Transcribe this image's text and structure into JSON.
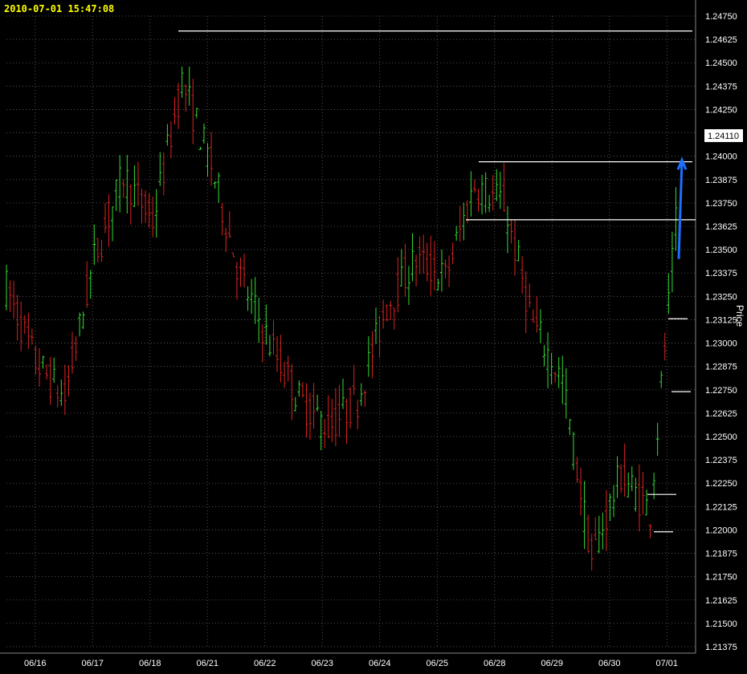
{
  "timestamp": "2010-07-01 15:47:08",
  "ylabel": "Price",
  "chart_data": {
    "type": "candlestick",
    "title": "",
    "x_tick_labels": [
      "06/16",
      "06/17",
      "06/18",
      "06/21",
      "06/22",
      "06/23",
      "06/24",
      "06/25",
      "06/28",
      "06/29",
      "06/30",
      "07/01"
    ],
    "y_ticks": [
      1.2475,
      1.24625,
      1.245,
      1.24375,
      1.2425,
      1.24125,
      1.24,
      1.23875,
      1.2375,
      1.23625,
      1.235,
      1.23375,
      1.2325,
      1.23125,
      1.23,
      1.22875,
      1.2275,
      1.22625,
      1.225,
      1.22375,
      1.2225,
      1.22125,
      1.22,
      1.21875,
      1.2175,
      1.21625,
      1.215,
      1.21375
    ],
    "y_tick_labels": [
      "1.24750",
      "1.24625",
      "1.24500",
      "1.24375",
      "1.24250",
      "1.24125",
      "1.24000",
      "1.23875",
      "1.23750",
      "1.23625",
      "1.23500",
      "1.23375",
      "1.23250",
      "1.23125",
      "1.23000",
      "1.22875",
      "1.22750",
      "1.22625",
      "1.22500",
      "1.22375",
      "1.22250",
      "1.22125",
      "1.22000",
      "1.21875",
      "1.21750",
      "1.21625",
      "1.21500",
      "1.21375"
    ],
    "ylim": [
      1.21375,
      1.2475
    ],
    "current_price": "1.24110",
    "grid": true,
    "colors": {
      "up": "#33dd33",
      "down": "#dd2222",
      "grid": "#666666",
      "line": "#ffffff",
      "arrow": "#1e6fff",
      "price_box_bg": "#ffffff",
      "price_box_text": "#000000"
    },
    "daily_close_path": [
      {
        "date": "06/16",
        "price": 1.233
      },
      {
        "date": "06/16",
        "price": 1.229
      },
      {
        "date": "06/17",
        "price": 1.227
      },
      {
        "date": "06/17",
        "price": 1.2345
      },
      {
        "date": "06/18",
        "price": 1.239
      },
      {
        "date": "06/18",
        "price": 1.2365
      },
      {
        "date": "06/21",
        "price": 1.244
      },
      {
        "date": "06/21",
        "price": 1.2395
      },
      {
        "date": "06/22",
        "price": 1.2335
      },
      {
        "date": "06/22",
        "price": 1.23
      },
      {
        "date": "06/23",
        "price": 1.227
      },
      {
        "date": "06/23",
        "price": 1.2255
      },
      {
        "date": "06/24",
        "price": 1.227
      },
      {
        "date": "06/24",
        "price": 1.232
      },
      {
        "date": "06/25",
        "price": 1.2345
      },
      {
        "date": "06/25",
        "price": 1.2335
      },
      {
        "date": "06/28",
        "price": 1.2385
      },
      {
        "date": "06/28",
        "price": 1.2375
      },
      {
        "date": "06/29",
        "price": 1.231
      },
      {
        "date": "06/29",
        "price": 1.228
      },
      {
        "date": "06/30",
        "price": 1.2185
      },
      {
        "date": "06/30",
        "price": 1.223
      },
      {
        "date": "07/01",
        "price": 1.221
      },
      {
        "date": "07/01",
        "price": 1.2385
      }
    ],
    "horizontal_lines": [
      1.2467,
      1.2397,
      1.2366
    ],
    "short_levels": [
      1.2313,
      1.2274,
      1.2219,
      1.2199
    ],
    "arrow": {
      "from": 1.2345,
      "to": 1.2398
    }
  }
}
